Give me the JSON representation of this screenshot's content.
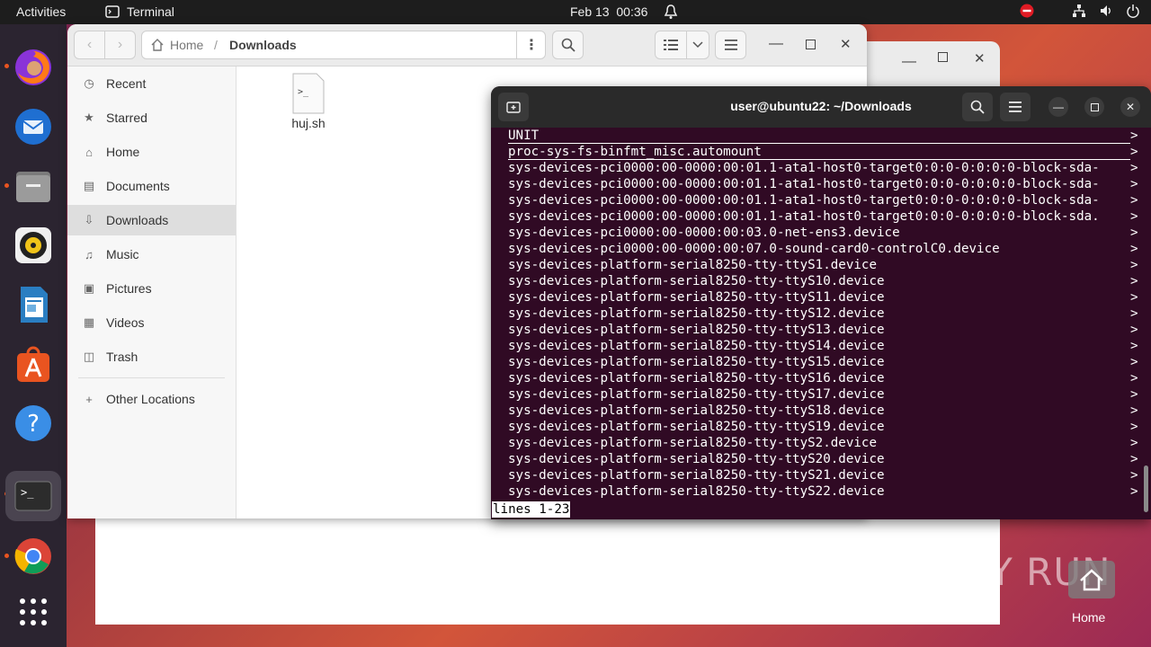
{
  "topbar": {
    "activities": "Activities",
    "app_name": "Terminal",
    "clock": "Feb 13  00:36"
  },
  "dock": {
    "items": [
      "Firefox",
      "Thunderbird",
      "Files",
      "Rhythmbox",
      "LibreOffice Writer",
      "Ubuntu Software",
      "Help",
      "Terminal",
      "Google Chrome",
      "Show Applications"
    ]
  },
  "file_manager": {
    "breadcrumb_home": "Home",
    "breadcrumb_current": "Downloads",
    "sidebar": [
      {
        "label": "Recent",
        "icon": "clock-icon"
      },
      {
        "label": "Starred",
        "icon": "star-icon"
      },
      {
        "label": "Home",
        "icon": "home-icon"
      },
      {
        "label": "Documents",
        "icon": "document-icon"
      },
      {
        "label": "Downloads",
        "icon": "download-icon"
      },
      {
        "label": "Music",
        "icon": "music-icon"
      },
      {
        "label": "Pictures",
        "icon": "picture-icon"
      },
      {
        "label": "Videos",
        "icon": "video-icon"
      },
      {
        "label": "Trash",
        "icon": "trash-icon"
      },
      {
        "label": "Other Locations",
        "icon": "plus-icon"
      }
    ],
    "files": [
      {
        "name": "huj.sh",
        "glyph": ">_"
      }
    ]
  },
  "terminal": {
    "title": "user@ubuntu22: ~/Downloads",
    "lines": [
      "UNIT",
      "proc-sys-fs-binfmt_misc.automount",
      "sys-devices-pci0000:00-0000:00:01.1-ata1-host0-target0:0:0-0:0:0:0-block-sda-",
      "sys-devices-pci0000:00-0000:00:01.1-ata1-host0-target0:0:0-0:0:0:0-block-sda-",
      "sys-devices-pci0000:00-0000:00:01.1-ata1-host0-target0:0:0-0:0:0:0-block-sda-",
      "sys-devices-pci0000:00-0000:00:01.1-ata1-host0-target0:0:0-0:0:0:0-block-sda.",
      "sys-devices-pci0000:00-0000:00:03.0-net-ens3.device",
      "sys-devices-pci0000:00-0000:00:07.0-sound-card0-controlC0.device",
      "sys-devices-platform-serial8250-tty-ttyS1.device",
      "sys-devices-platform-serial8250-tty-ttyS10.device",
      "sys-devices-platform-serial8250-tty-ttyS11.device",
      "sys-devices-platform-serial8250-tty-ttyS12.device",
      "sys-devices-platform-serial8250-tty-ttyS13.device",
      "sys-devices-platform-serial8250-tty-ttyS14.device",
      "sys-devices-platform-serial8250-tty-ttyS15.device",
      "sys-devices-platform-serial8250-tty-ttyS16.device",
      "sys-devices-platform-serial8250-tty-ttyS17.device",
      "sys-devices-platform-serial8250-tty-ttyS18.device",
      "sys-devices-platform-serial8250-tty-ttyS19.device",
      "sys-devices-platform-serial8250-tty-ttyS2.device",
      "sys-devices-platform-serial8250-tty-ttyS20.device",
      "sys-devices-platform-serial8250-tty-ttyS21.device",
      "sys-devices-platform-serial8250-tty-ttyS22.device"
    ],
    "overflow_marker": ">",
    "status_line": "lines 1-23"
  },
  "desktop": {
    "home_label": "Home",
    "watermark": "ANY RUN"
  },
  "colors": {
    "terminal_bg": "#300a24",
    "accent": "#e95420"
  }
}
